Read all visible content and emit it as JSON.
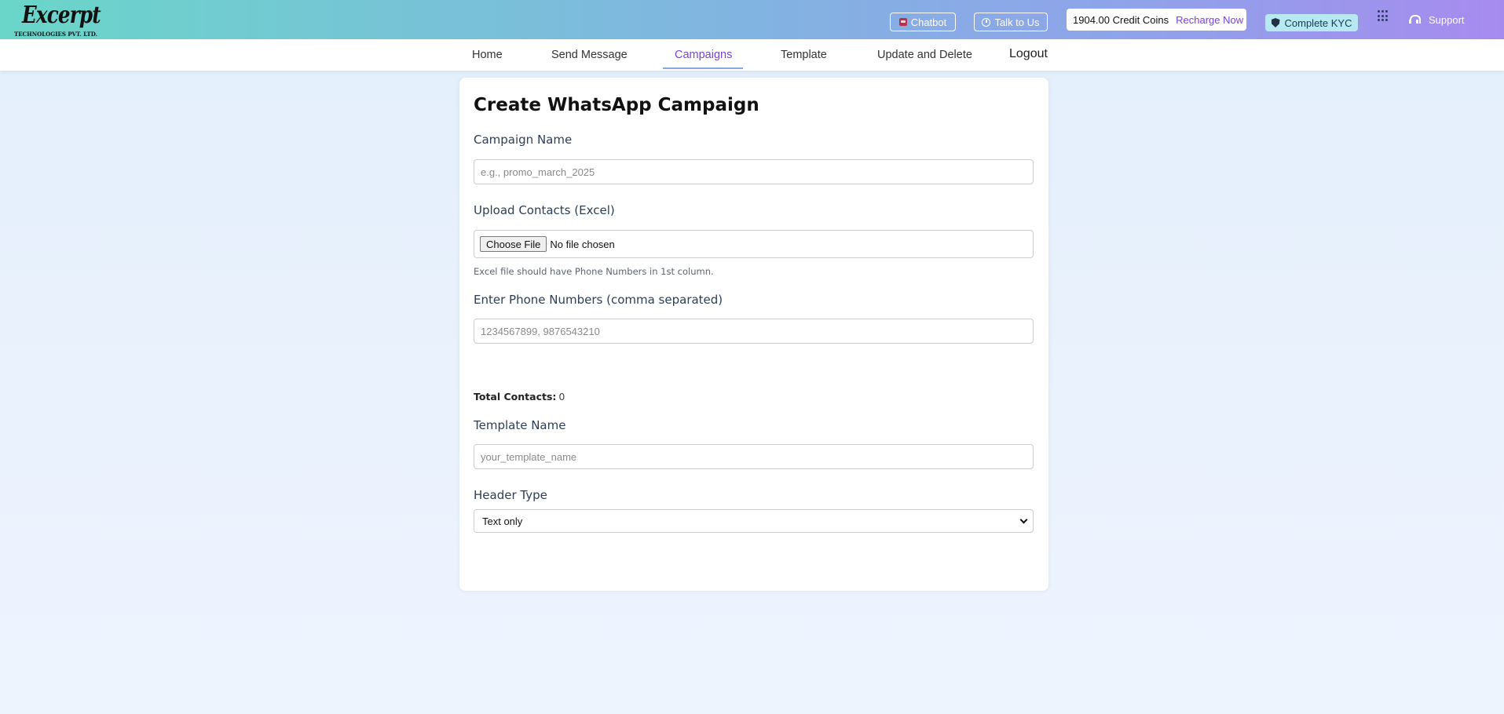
{
  "brand": {
    "name": "Excerpt",
    "subtitle": "TECHNOLOGIES PVT. LTD."
  },
  "header": {
    "chatbot_label": "Chatbot",
    "talk_label": "Talk to Us",
    "credits": "1904.00 Credit Coins",
    "recharge_label": "Recharge Now",
    "kyc_label": "Complete KYC",
    "support_label": "Support"
  },
  "nav": {
    "items": [
      {
        "label": "Home"
      },
      {
        "label": "Send Message"
      },
      {
        "label": "Campaigns",
        "active": true
      },
      {
        "label": "Template"
      },
      {
        "label": "Update and Delete"
      }
    ],
    "logout_label": "Logout",
    "active_color": "#7b3fe0"
  },
  "form": {
    "title": "Create WhatsApp Campaign",
    "campaign_name": {
      "label": "Campaign Name",
      "placeholder": "e.g., promo_march_2025",
      "value": ""
    },
    "upload": {
      "label": "Upload Contacts (Excel)",
      "button_label": "Choose File",
      "status": "No file chosen",
      "hint": "Excel file should have Phone Numbers in 1st column."
    },
    "phones": {
      "label": "Enter Phone Numbers (comma separated)",
      "placeholder": "1234567899, 9876543210",
      "value": ""
    },
    "total_contacts": {
      "label": "Total Contacts:",
      "value": "0"
    },
    "template_name": {
      "label": "Template Name",
      "placeholder": "your_template_name",
      "value": ""
    },
    "header_type": {
      "label": "Header Type",
      "selected": "Text only"
    }
  }
}
